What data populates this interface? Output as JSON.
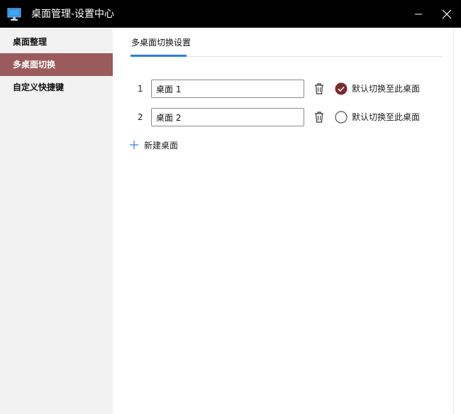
{
  "window": {
    "title": "桌面管理-设置中心",
    "app_icon": "monitor-icon",
    "minimize_icon": "minimize-icon",
    "close_icon": "close-icon"
  },
  "sidebar": {
    "items": [
      {
        "label": "桌面整理",
        "active": false
      },
      {
        "label": "多桌面切换",
        "active": true
      },
      {
        "label": "自定义快捷键",
        "active": false
      }
    ]
  },
  "main": {
    "tab": {
      "label": "多桌面切换设置"
    },
    "desktops": [
      {
        "index": "1",
        "name": "桌面 1",
        "default_label": "默认切换至此桌面",
        "is_default": true
      },
      {
        "index": "2",
        "name": "桌面 2",
        "default_label": "默认切换至此桌面",
        "is_default": false
      }
    ],
    "add_button": {
      "label": "新建桌面",
      "icon": "plus-icon"
    }
  },
  "colors": {
    "titlebar": "#000000",
    "sidebar_bg": "#f2f2f2",
    "sidebar_active": "#9b5a5c",
    "tab_accent": "#2b7fd6",
    "radio_checked": "#7a2b2e"
  }
}
